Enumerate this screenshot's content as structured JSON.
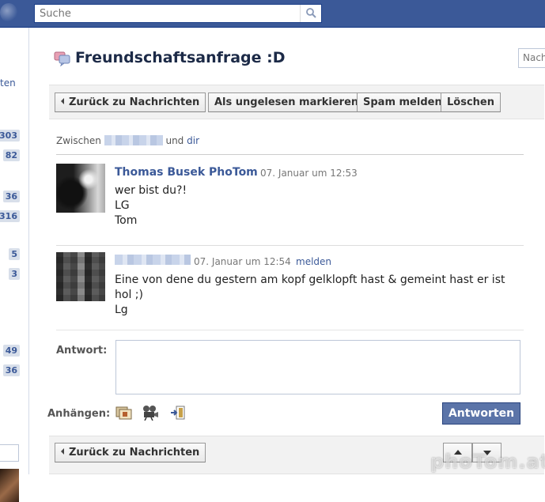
{
  "topbar": {
    "search": {
      "placeholder": "Suche"
    }
  },
  "left_sidebar": {
    "link_fragment": "ten",
    "counts": [
      "303",
      "82",
      "36",
      "316",
      "5",
      "3",
      "49",
      "36"
    ]
  },
  "header": {
    "title": "Freundschaftsanfrage :D",
    "right_input_placeholder": "Nach"
  },
  "toolbar_top": {
    "back_label": "Zurück zu Nachrichten",
    "mark_unread_label": "Als ungelesen markieren",
    "report_spam_label": "Spam melden",
    "delete_label": "Löschen"
  },
  "participants": {
    "prefix": "Zwischen",
    "joiner": "und",
    "self_link": "dir"
  },
  "messages": [
    {
      "author": "Thomas Busek PhoTom",
      "time": "07. Januar um 12:53",
      "lines": [
        "wer bist du?!",
        "LG",
        "Tom"
      ]
    },
    {
      "time": "07. Januar um 12:54",
      "report_link": "melden",
      "lines": [
        "Eine von dene du gestern am kopf gelklopft hast & gemeint hast er ist",
        "hol ;)",
        "Lg"
      ]
    }
  ],
  "reply": {
    "label": "Antwort:",
    "attach_label": "Anhängen:",
    "send_label": "Antworten"
  },
  "toolbar_bottom": {
    "back_label": "Zurück zu Nachrichten"
  },
  "watermark": "phoTom.at",
  "icons": [
    "search-icon",
    "messages-icon",
    "attach-photo-icon",
    "attach-video-icon",
    "attach-link-icon",
    "arrow-up-icon",
    "arrow-down-icon"
  ],
  "colors": {
    "brand": "#3b5998",
    "topbar": "#3b5998",
    "send_button": "#5b74a8"
  }
}
